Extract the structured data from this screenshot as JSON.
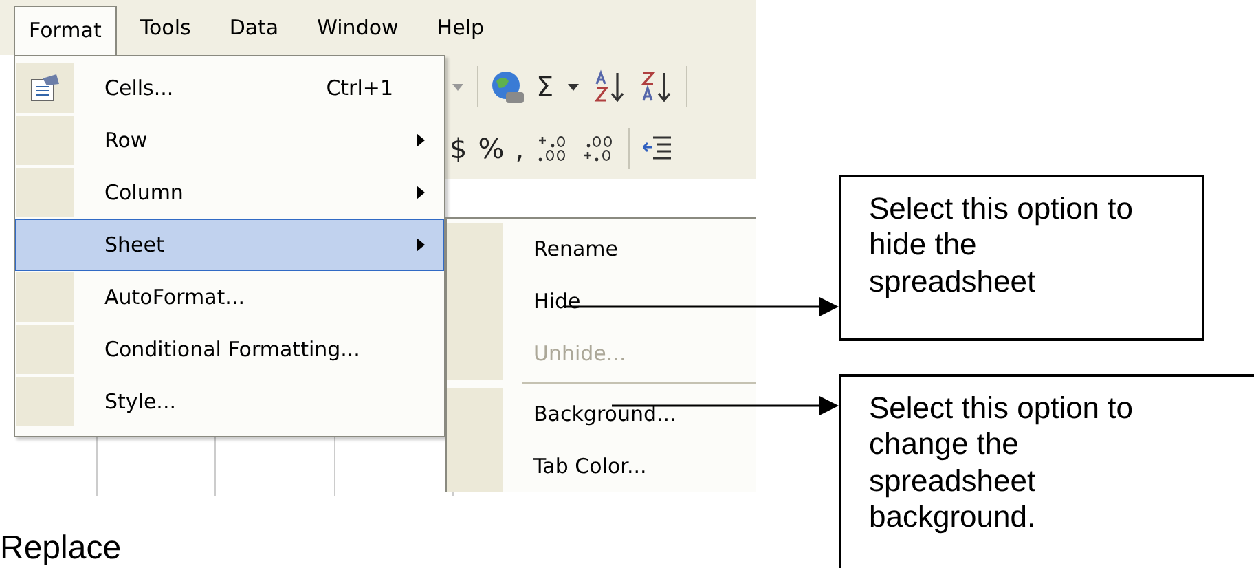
{
  "menu_bar": [
    {
      "label": "Format",
      "selected": true
    },
    {
      "label": "Tools",
      "selected": false
    },
    {
      "label": "Data",
      "selected": false
    },
    {
      "label": "Window",
      "selected": false
    },
    {
      "label": "Help",
      "selected": false
    }
  ],
  "toolbar": {
    "row_1": [
      "Σ"
    ],
    "row_2": [
      "$",
      "%",
      ","
    ]
  },
  "format_menu": [
    {
      "label": "Cells...",
      "shortcut": "Ctrl+1",
      "submenu": false,
      "selected": false,
      "icon": true
    },
    {
      "label": "Row",
      "submenu": true,
      "selected": false,
      "icon": false
    },
    {
      "label": "Column",
      "submenu": true,
      "selected": false,
      "icon": false
    },
    {
      "label": "Sheet",
      "submenu": true,
      "selected": true,
      "icon": false
    },
    {
      "label": "AutoFormat...",
      "submenu": false,
      "selected": false,
      "icon": false
    },
    {
      "label": "Conditional Formatting...",
      "submenu": false,
      "selected": false,
      "icon": false
    },
    {
      "label": "Style...",
      "submenu": false,
      "selected": false,
      "icon": false
    }
  ],
  "sheet_submenu": [
    {
      "kind": "item",
      "label": "Rename",
      "disabled": false
    },
    {
      "kind": "item",
      "label": "Hide",
      "disabled": false
    },
    {
      "kind": "item",
      "label": "Unhide...",
      "disabled": true
    },
    {
      "kind": "separator"
    },
    {
      "kind": "item",
      "label": "Background...",
      "disabled": false
    },
    {
      "kind": "item",
      "label": "Tab Color...",
      "disabled": false
    }
  ],
  "callouts": [
    "Select this option to hide the spreadsheet",
    "Select this option to change the spreadsheet background."
  ],
  "footer_text": "Replace"
}
